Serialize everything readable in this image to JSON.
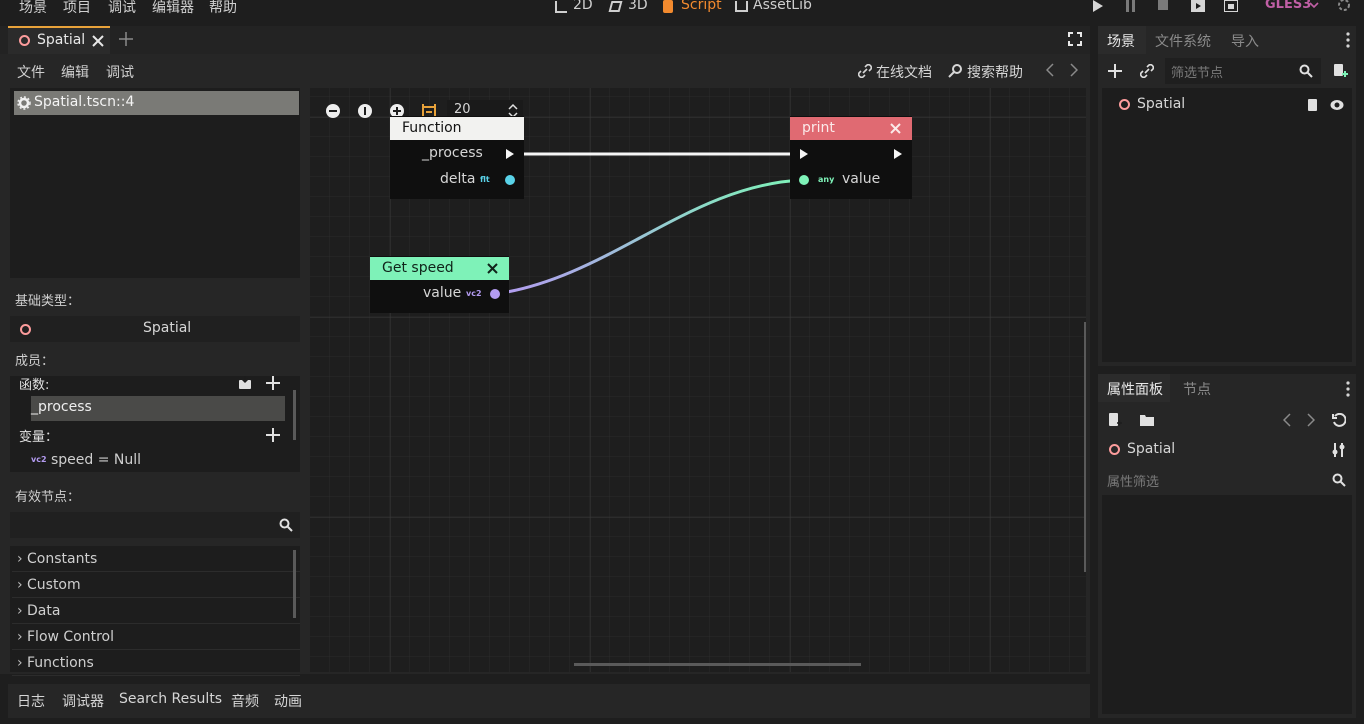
{
  "menu": {
    "scene": "场景",
    "project": "项目",
    "debug": "调试",
    "editor": "编辑器",
    "help": "帮助"
  },
  "workspaces": {
    "w2d": "2D",
    "w3d": "3D",
    "script": "Script",
    "assetlib": "AssetLib"
  },
  "renderer": "GLES3",
  "tab": {
    "label": "Spatial"
  },
  "script_menu": {
    "file": "文件",
    "edit": "编辑",
    "debug": "调试"
  },
  "help_links": {
    "online_docs": "在线文档",
    "search_help": "搜索帮助"
  },
  "script_list": {
    "item": "Spatial.tscn::4"
  },
  "base_type": {
    "label": "基础类型：",
    "value": "Spatial"
  },
  "members": {
    "label": "成员：",
    "functions_label": "函数:",
    "function_item": "_process",
    "variables_label": "变量：",
    "var_type": "vc2",
    "var_item": "speed = Null"
  },
  "available_nodes": {
    "label": "有效节点：",
    "items": [
      "Constants",
      "Custom",
      "Data",
      "Flow Control",
      "Functions"
    ]
  },
  "graph": {
    "zoom_value": "20",
    "nodes": {
      "function": {
        "title": "Function",
        "port1": "_process",
        "port2": "delta",
        "port2_type": "flt"
      },
      "print": {
        "title": "print",
        "port_type": "any",
        "port": "value"
      },
      "get_speed": {
        "title": "Get speed",
        "port": "value",
        "port_type": "vc2"
      }
    }
  },
  "scene_dock": {
    "tabs": [
      "场景",
      "文件系统",
      "导入"
    ],
    "filter_placeholder": "筛选节点",
    "root": "Spatial"
  },
  "inspector": {
    "tabs": [
      "属性面板",
      "节点"
    ],
    "object": "Spatial",
    "filter_placeholder": "属性筛选"
  },
  "bottom": {
    "tabs": [
      "日志",
      "调试器",
      "Search Results",
      "音频",
      "动画"
    ]
  },
  "colors": {
    "accent_orange": "#e8a23a",
    "script_orange": "#f28a2e",
    "gles_pink": "#c05fa5",
    "node_function": "#f2f2f0",
    "node_print": "#e06a72",
    "node_getspeed": "#7ef2b8",
    "port_flt": "#59d2e8",
    "port_vc2": "#b39bf0"
  }
}
